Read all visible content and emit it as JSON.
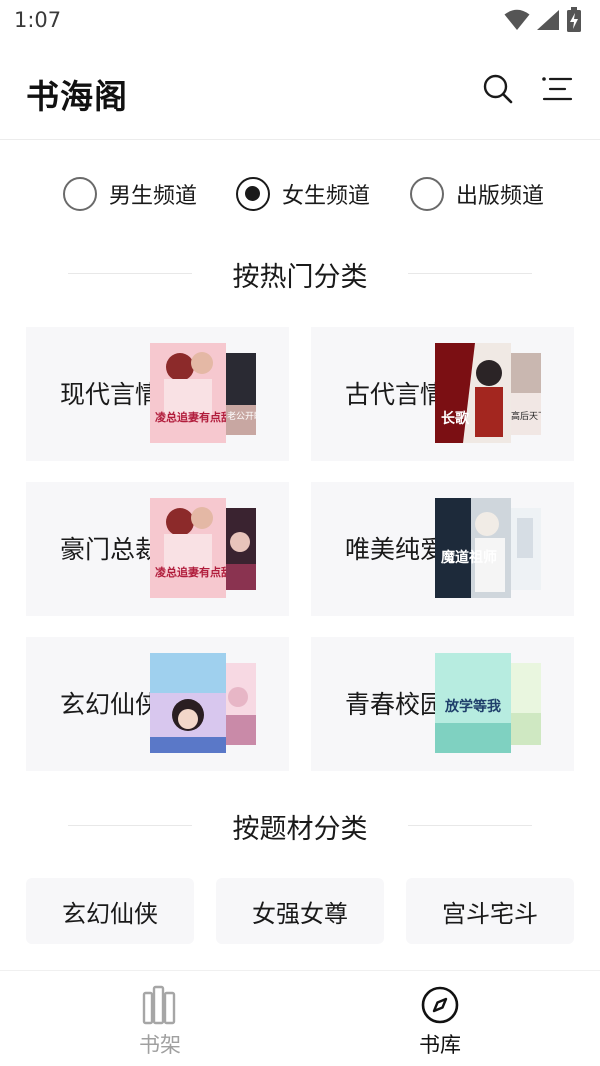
{
  "status_bar": {
    "time": "1:07",
    "icons": [
      "wifi-icon",
      "signal-icon",
      "battery-charging-icon"
    ]
  },
  "header": {
    "title": "书海阁",
    "icons": [
      "search-icon",
      "menu-icon"
    ]
  },
  "channels": [
    {
      "label": "男生频道",
      "selected": false
    },
    {
      "label": "女生频道",
      "selected": true
    },
    {
      "label": "出版频道",
      "selected": false
    }
  ],
  "popular_section": {
    "heading": "按热门分类",
    "categories": [
      {
        "label": "现代言情",
        "cover_front_text": "凌总追妻有点甜",
        "cover_back_text": "老公开眼",
        "colors": [
          "#f6c8cf",
          "#b11d3c"
        ]
      },
      {
        "label": "古代言情",
        "cover_front_text": "长歌",
        "cover_back_text": "高后天下",
        "colors": [
          "#f0e9e4",
          "#7b0f13"
        ]
      },
      {
        "label": "豪门总裁",
        "cover_front_text": "凌总追妻有点甜",
        "cover_back_text": "",
        "colors": [
          "#f6c8cf",
          "#b11d3c"
        ]
      },
      {
        "label": "唯美纯爱",
        "cover_front_text": "魔道祖师",
        "cover_back_text": "",
        "colors": [
          "#cfd6dc",
          "#1d2a3a"
        ]
      },
      {
        "label": "玄幻仙侠",
        "cover_front_text": "",
        "cover_back_text": "",
        "colors": [
          "#d8c7ee",
          "#5a78c8"
        ]
      },
      {
        "label": "青春校园",
        "cover_front_text": "放学等我",
        "cover_back_text": "",
        "colors": [
          "#b7ece0",
          "#1f7e6b"
        ]
      }
    ]
  },
  "topic_section": {
    "heading": "按题材分类",
    "topics": [
      "玄幻仙侠",
      "女强女尊",
      "宫斗宅斗"
    ]
  },
  "bottom_nav": {
    "items": [
      {
        "label": "书架",
        "icon": "bookshelf-icon",
        "active": false
      },
      {
        "label": "书库",
        "icon": "compass-icon",
        "active": true
      }
    ]
  }
}
